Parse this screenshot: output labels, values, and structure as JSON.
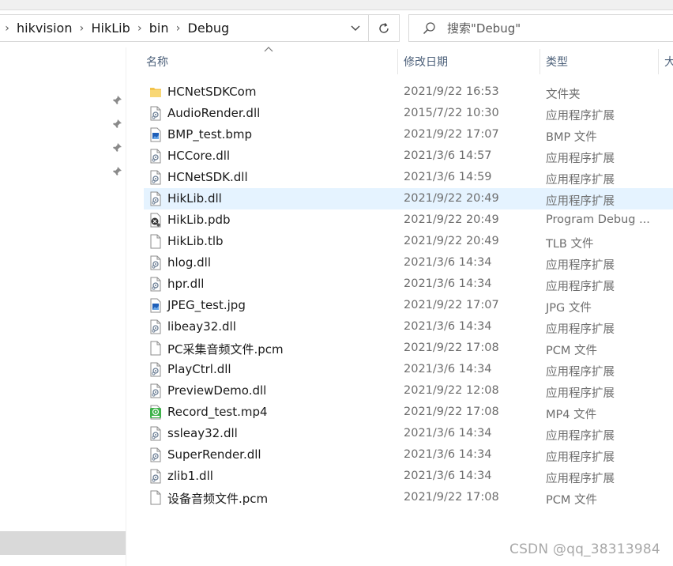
{
  "breadcrumb": {
    "segments": [
      "hikvision",
      "HikLib",
      "bin",
      "Debug"
    ],
    "separator": ">"
  },
  "search": {
    "placeholder": "搜索\"Debug\""
  },
  "columns": {
    "name": "名称",
    "date": "修改日期",
    "type": "类型",
    "size": "大"
  },
  "colors": {
    "selected_row": "#e5f3ff",
    "header_text": "#4c607a",
    "folder": "#f3c34b"
  },
  "files": [
    {
      "name": "HCNetSDKCom",
      "date": "2021/9/22 16:53",
      "type": "文件夹",
      "icon": "folder-icon"
    },
    {
      "name": "AudioRender.dll",
      "date": "2015/7/22 10:30",
      "type": "应用程序扩展",
      "icon": "dll-icon"
    },
    {
      "name": "BMP_test.bmp",
      "date": "2021/9/22 17:07",
      "type": "BMP 文件",
      "icon": "image-icon"
    },
    {
      "name": "HCCore.dll",
      "date": "2021/3/6 14:57",
      "type": "应用程序扩展",
      "icon": "dll-icon"
    },
    {
      "name": "HCNetSDK.dll",
      "date": "2021/3/6 14:59",
      "type": "应用程序扩展",
      "icon": "dll-icon"
    },
    {
      "name": "HikLib.dll",
      "date": "2021/9/22 20:49",
      "type": "应用程序扩展",
      "icon": "dll-icon",
      "selected": true
    },
    {
      "name": "HikLib.pdb",
      "date": "2021/9/22 20:49",
      "type": "Program Debug ...",
      "icon": "pdb-icon"
    },
    {
      "name": "HikLib.tlb",
      "date": "2021/9/22 20:49",
      "type": "TLB 文件",
      "icon": "file-icon"
    },
    {
      "name": "hlog.dll",
      "date": "2021/3/6 14:34",
      "type": "应用程序扩展",
      "icon": "dll-icon"
    },
    {
      "name": "hpr.dll",
      "date": "2021/3/6 14:34",
      "type": "应用程序扩展",
      "icon": "dll-icon"
    },
    {
      "name": "JPEG_test.jpg",
      "date": "2021/9/22 17:07",
      "type": "JPG 文件",
      "icon": "image-icon"
    },
    {
      "name": "libeay32.dll",
      "date": "2021/3/6 14:34",
      "type": "应用程序扩展",
      "icon": "dll-icon"
    },
    {
      "name": "PC采集音频文件.pcm",
      "date": "2021/9/22 17:08",
      "type": "PCM 文件",
      "icon": "file-icon"
    },
    {
      "name": "PlayCtrl.dll",
      "date": "2021/3/6 14:34",
      "type": "应用程序扩展",
      "icon": "dll-icon"
    },
    {
      "name": "PreviewDemo.dll",
      "date": "2021/9/22 12:08",
      "type": "应用程序扩展",
      "icon": "dll-icon"
    },
    {
      "name": "Record_test.mp4",
      "date": "2021/9/22 17:08",
      "type": "MP4 文件",
      "icon": "video-icon"
    },
    {
      "name": "ssleay32.dll",
      "date": "2021/3/6 14:34",
      "type": "应用程序扩展",
      "icon": "dll-icon"
    },
    {
      "name": "SuperRender.dll",
      "date": "2021/3/6 14:34",
      "type": "应用程序扩展",
      "icon": "dll-icon"
    },
    {
      "name": "zlib1.dll",
      "date": "2021/3/6 14:34",
      "type": "应用程序扩展",
      "icon": "dll-icon"
    },
    {
      "name": "设备音频文件.pcm",
      "date": "2021/9/22 17:08",
      "type": "PCM 文件",
      "icon": "file-icon"
    }
  ],
  "watermark": "CSDN @qq_38313984"
}
